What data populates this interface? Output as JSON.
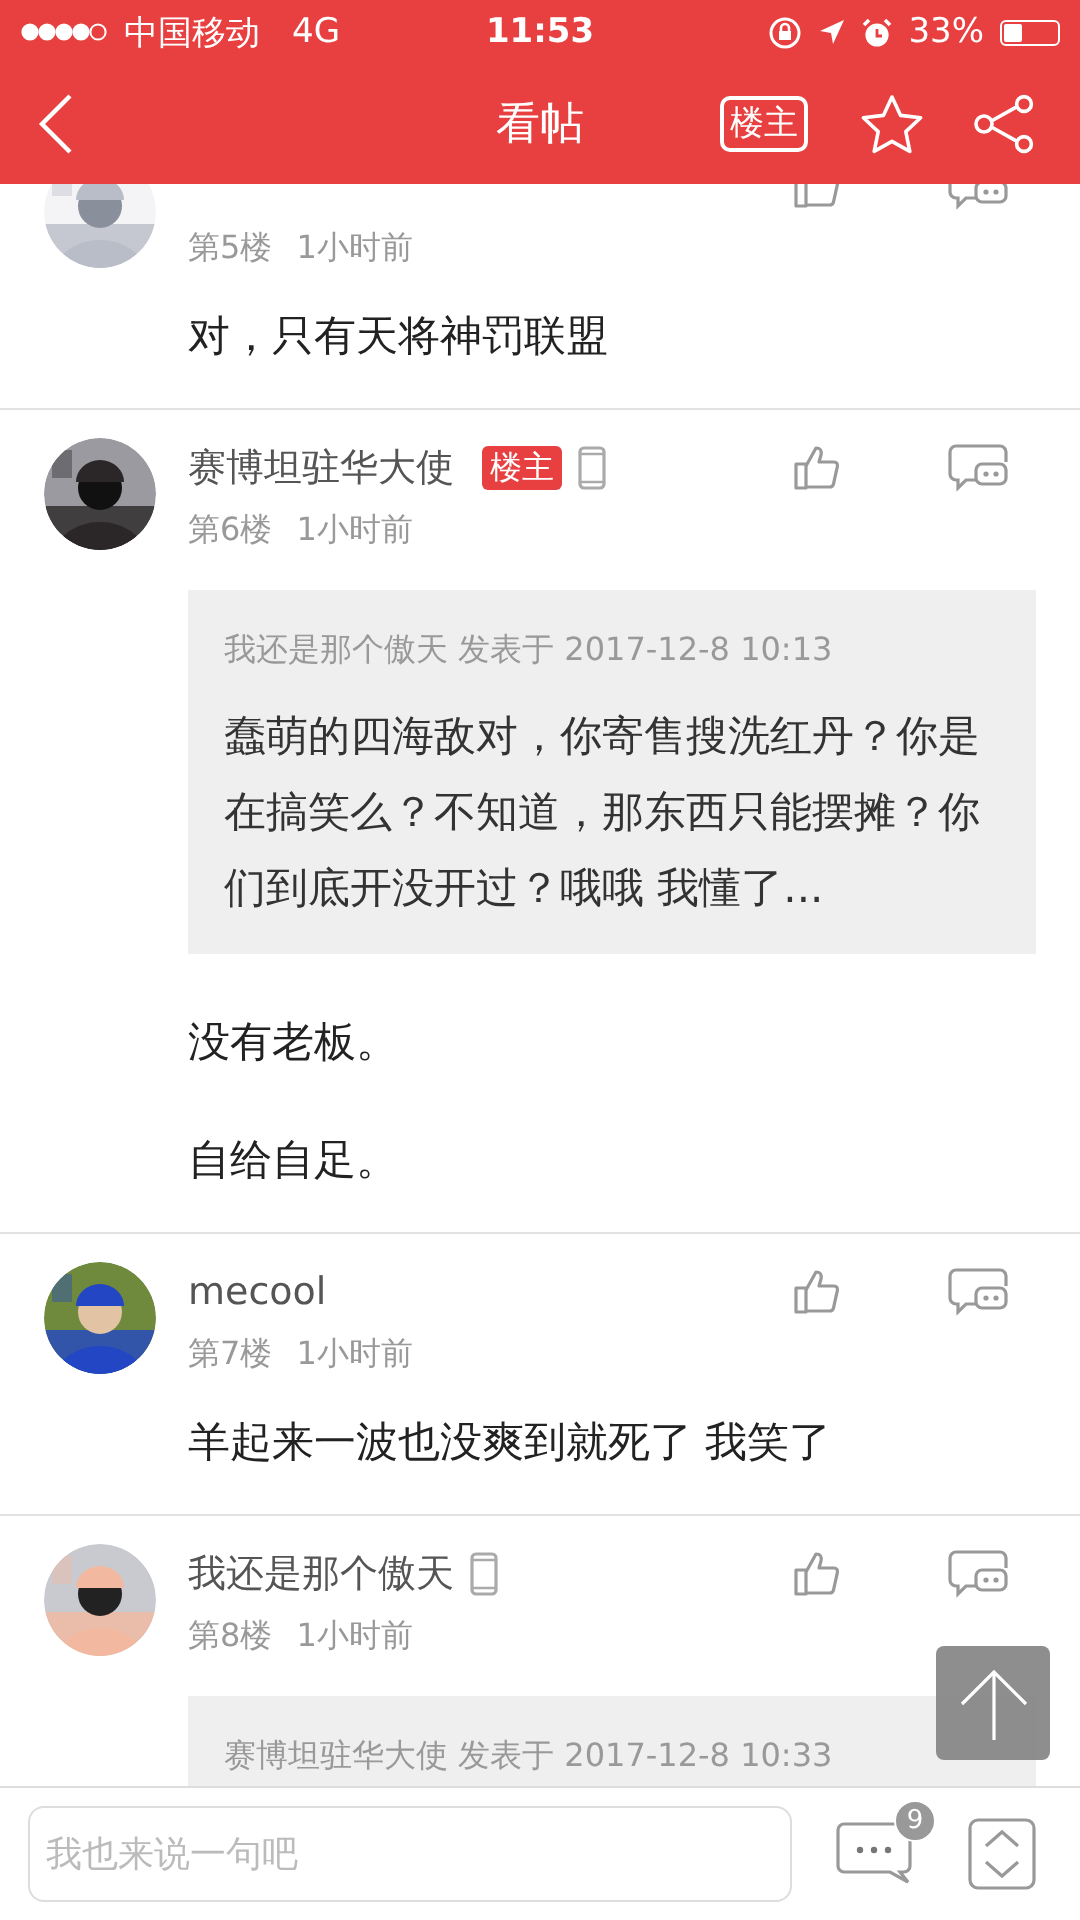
{
  "status_bar": {
    "carrier": "中国移动",
    "network": "4G",
    "time": "11:53",
    "battery": "33%"
  },
  "header": {
    "title": "看帖",
    "owner_button": "楼主"
  },
  "posts": [
    {
      "floor": "第5楼",
      "time": "1小时前",
      "device": false,
      "paragraphs": [
        "对，只有天将神罚联盟"
      ]
    },
    {
      "name": "赛博坦驻华大使",
      "owner_badge": "楼主",
      "device": true,
      "floor": "第6楼",
      "time": "1小时前",
      "quote": {
        "header": "我还是那个傲天 发表于 2017-12-8 10:13",
        "text": "蠢萌的四海敌对，你寄售搜洗红丹？你是在搞笑么？不知道，那东西只能摆摊？你们到底开没开过？哦哦 我懂了..."
      },
      "paragraphs": [
        "没有老板。",
        "自给自足。"
      ]
    },
    {
      "name": "mecool",
      "device": false,
      "floor": "第7楼",
      "time": "1小时前",
      "paragraphs": [
        "羊起来一波也没爽到就死了 我笑了"
      ]
    },
    {
      "name": "我还是那个傲天",
      "device": true,
      "floor": "第8楼",
      "time": "1小时前",
      "quote": {
        "header": "赛博坦驻华大使 发表于 2017-12-8 10:33"
      }
    }
  ],
  "composer": {
    "placeholder": "我也来说一句吧",
    "comment_count": "9"
  }
}
